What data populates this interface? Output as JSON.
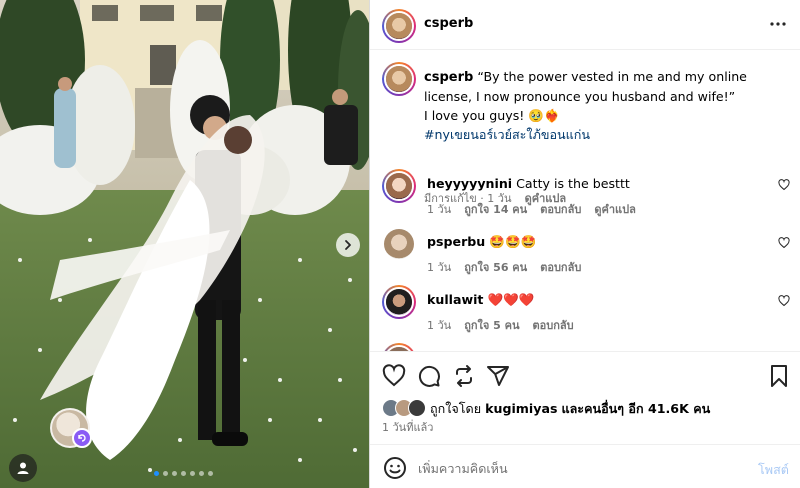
{
  "post": {
    "author": "csperb",
    "carousel_dots": 7,
    "active_dot": 0
  },
  "caption": {
    "username": "csperb",
    "text_line": "“By the power vested in me and my online license, I now pronounce you husband and wife!”",
    "text_love": "I love you guys! 🥹❤️‍🔥",
    "hashtag": "#nyเขยนอร์เวย์สะใภ้ขอนแก่น",
    "edited": "มีการแก้ไข · 1 วัน",
    "translate": "ดูคำแปล"
  },
  "comments": [
    {
      "username": "heyyyyynini",
      "text": "Catty is the besttt",
      "age": "1 วัน",
      "likes": "ถูกใจ 14 คน",
      "reply": "ตอบกลับ",
      "translate": "ดูคำแปล"
    },
    {
      "username": "psperbu",
      "text": "🤩🤩🤩",
      "age": "1 วัน",
      "likes": "ถูกใจ 56 คน",
      "reply": "ตอบกลับ",
      "translate": ""
    },
    {
      "username": "kullawit",
      "text": "❤️❤️❤️",
      "age": "1 วัน",
      "likes": "ถูกใจ 5 คน",
      "reply": "ตอบกลับ",
      "translate": ""
    }
  ],
  "likes": {
    "prefix": "ถูกใจโดย",
    "user": "kugimiyas",
    "suffix": "และคนอื่นๆ อีก 41.6K คน"
  },
  "post_time": "1 วันที่แล้ว",
  "add_comment": {
    "placeholder": "เพิ่มความคิดเห็น",
    "post_label": "โพสต์"
  },
  "icons": {
    "more": "more-horizontal-icon",
    "like": "heart-outline-icon",
    "comment": "comment-bubble-icon",
    "repost": "repost-icon",
    "share": "share-paper-plane-icon",
    "save": "bookmark-icon",
    "emoji": "emoji-smiley-icon",
    "next": "chevron-right-icon",
    "tag": "user-tag-icon"
  },
  "colors": {
    "link": "#00376b",
    "muted": "#737373",
    "post_disabled": "#a9c9f5",
    "heart": "#ed4956",
    "accent_dot": "#1e90ff"
  }
}
